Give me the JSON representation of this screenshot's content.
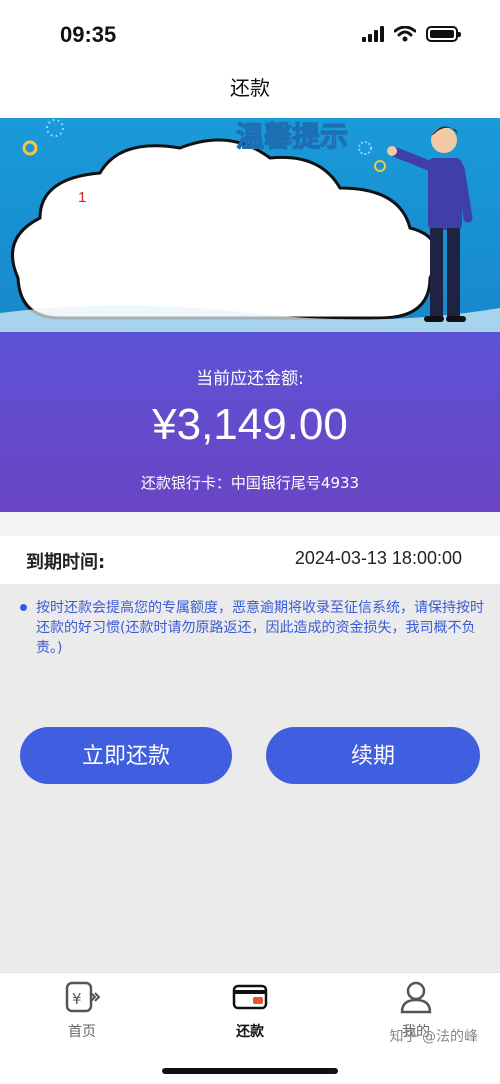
{
  "status": {
    "time": "09:35"
  },
  "nav": {
    "title": "还款"
  },
  "banner": {
    "heading": "温馨提示",
    "marker": "1"
  },
  "amount": {
    "label": "当前应还金额:",
    "value": "¥3,149.00",
    "bank_card": "还款银行卡：中国银行尾号4933"
  },
  "due": {
    "label": "到期时间:",
    "value": "2024-03-13 18:00:00"
  },
  "notice": {
    "text": "按时还款会提高您的专属额度，恶意逾期将收录至征信系统，请保持按时还款的好习惯(还款时请勿原路返还，因此造成的资金损失，我司概不负责。)"
  },
  "buttons": {
    "repay_now": "立即还款",
    "renew": "续期"
  },
  "tabs": [
    {
      "label": "首页",
      "icon": "yen-icon",
      "active": false
    },
    {
      "label": "还款",
      "icon": "wallet-icon",
      "active": true
    },
    {
      "label": "我的",
      "icon": "user-icon",
      "active": false
    }
  ],
  "watermark": "知乎 @法的峰",
  "colors": {
    "accent": "#3f5ee0",
    "card": "#5d52d6",
    "banner": "#1a9ad8",
    "notice": "#3b5bd6"
  }
}
